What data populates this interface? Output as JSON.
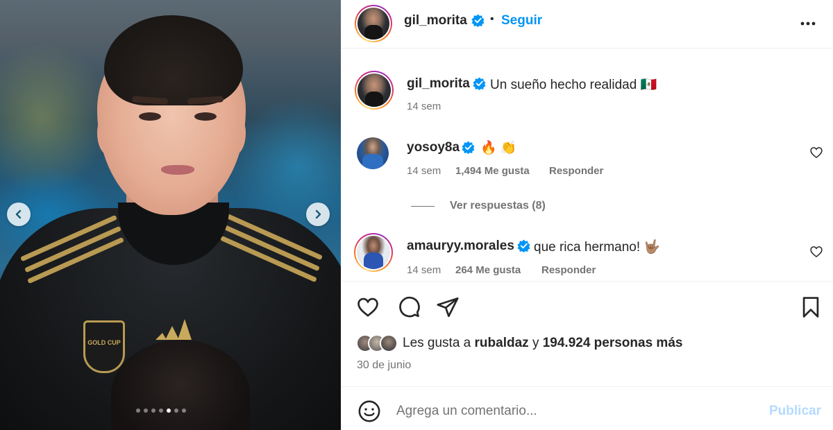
{
  "post": {
    "author": "gil_morita",
    "follow_label": "Seguir",
    "separator": "•",
    "photo_badge_text": "GOLD CUP",
    "carousel": {
      "total": 7,
      "active_index": 4
    }
  },
  "caption": {
    "username": "gil_morita",
    "text": "Un sueño hecho realidad 🇲🇽",
    "time": "14 sem"
  },
  "comments": [
    {
      "username": "yosoy8a",
      "text": "🔥 👏",
      "time": "14 sem",
      "likes": "1,494 Me gusta",
      "reply_label": "Responder"
    },
    {
      "username": "amauryy.morales",
      "text": "que rica hermano! 🤟🏽",
      "time": "14 sem",
      "likes": "264 Me gusta",
      "reply_label": "Responder"
    }
  ],
  "view_replies_label": "Ver respuestas (8)",
  "likes_summary": {
    "prefix": "Les gusta a",
    "user": "rubaldaz",
    "connector": "y",
    "count": "194.924 personas más"
  },
  "date": "30 de junio",
  "composer": {
    "placeholder": "Agrega un comentario...",
    "publish_label": "Publicar"
  },
  "colors": {
    "accent": "#0095f6",
    "publish_disabled": "#b3dbff",
    "muted_text": "#737373",
    "verified_badge": "#0095f6"
  },
  "icons": [
    "chevron-left-icon",
    "chevron-right-icon",
    "verified-icon",
    "more-icon",
    "heart-icon",
    "comment-icon",
    "share-icon",
    "bookmark-icon",
    "emoji-icon"
  ]
}
